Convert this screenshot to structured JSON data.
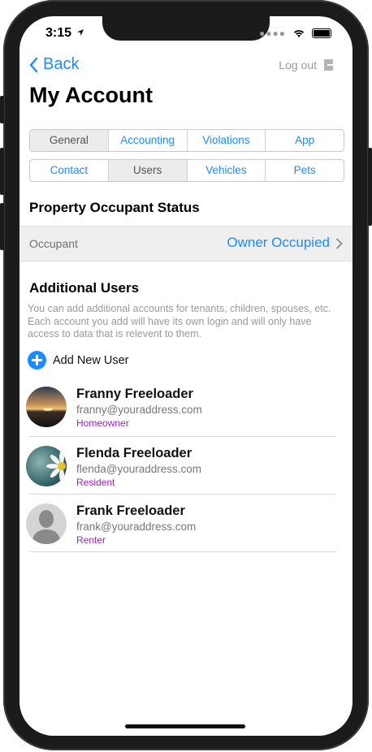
{
  "status_bar": {
    "time": "3:15"
  },
  "nav": {
    "back_label": "Back",
    "logout_label": "Log out"
  },
  "page_title": "My Account",
  "tabs_row1": [
    {
      "label": "General",
      "active": true
    },
    {
      "label": "Accounting",
      "active": false
    },
    {
      "label": "Violations",
      "active": false
    },
    {
      "label": "App",
      "active": false
    }
  ],
  "tabs_row2": [
    {
      "label": "Contact",
      "active": false
    },
    {
      "label": "Users",
      "active": true
    },
    {
      "label": "Vehicles",
      "active": false
    },
    {
      "label": "Pets",
      "active": false
    }
  ],
  "property_status": {
    "heading": "Property Occupant Status",
    "label": "Occupant",
    "value": "Owner Occupied"
  },
  "additional_users": {
    "heading": "Additional Users",
    "description": "You can add additional accounts for tenants, children, spouses, etc.  Each account you add will have its own login and will only have access to data that is relevent to them.",
    "add_label": "Add New User",
    "users": [
      {
        "name": "Franny Freeloader",
        "email": "franny@youraddress.com",
        "role": "Homeowner",
        "avatar": "sunset-photo"
      },
      {
        "name": "Flenda Freeloader",
        "email": "flenda@youraddress.com",
        "role": "Resident",
        "avatar": "daisy-photo"
      },
      {
        "name": "Frank Freeloader",
        "email": "frank@youraddress.com",
        "role": "Renter",
        "avatar": "person-silhouette-icon"
      }
    ]
  },
  "colors": {
    "accent": "#1a8cff",
    "role": "#a020c0",
    "muted": "#9a9a9a"
  }
}
